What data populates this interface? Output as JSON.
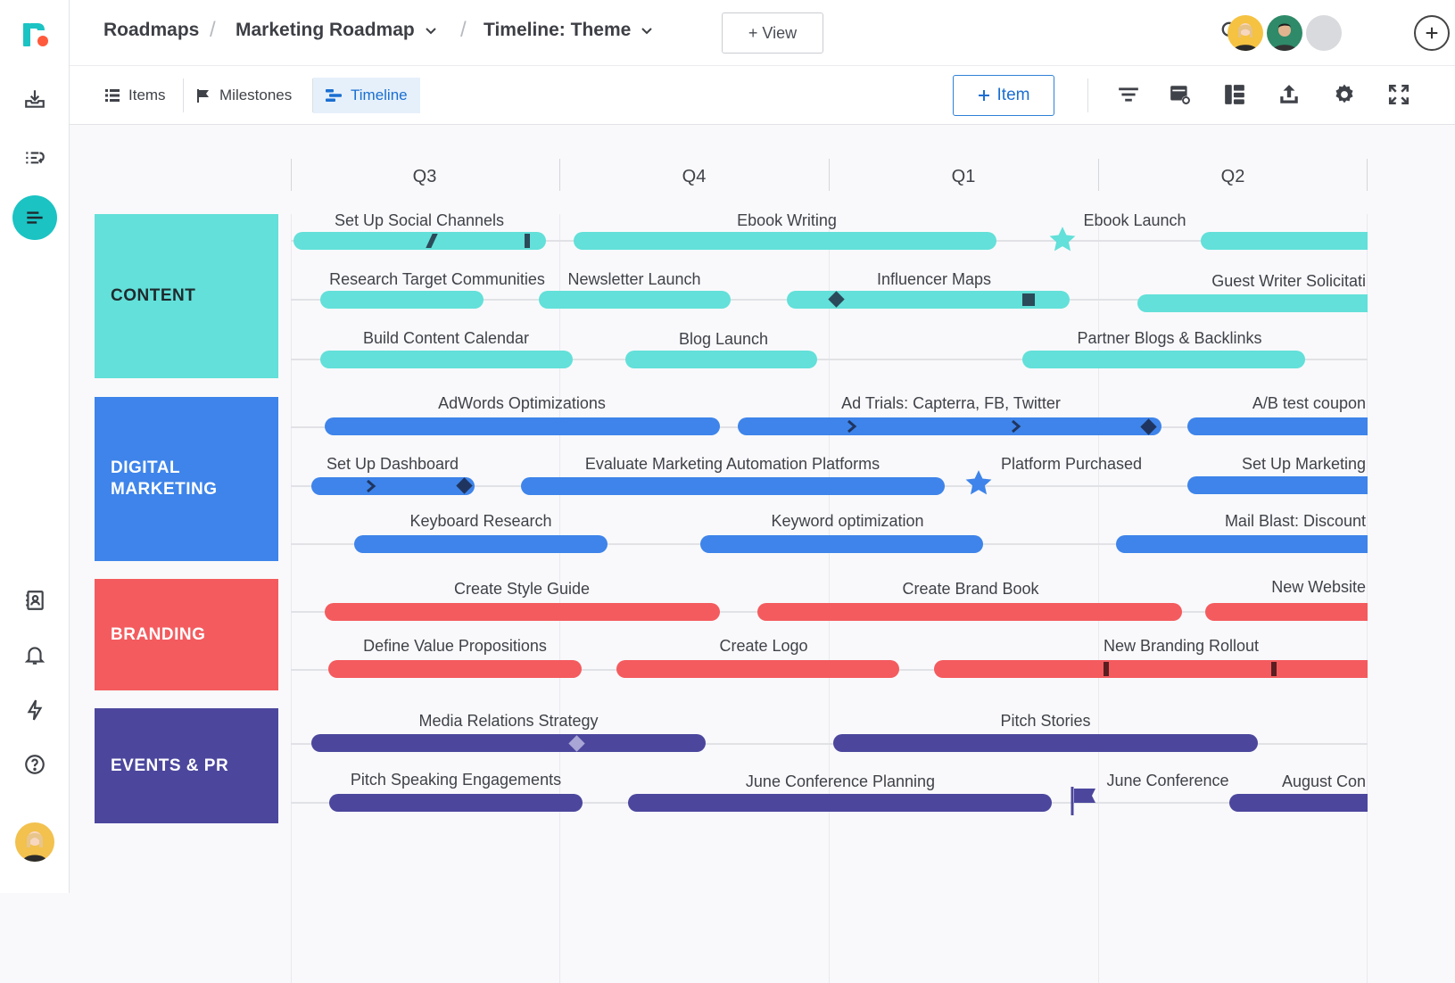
{
  "app": {
    "brand_color": "#1bc3c3",
    "accent_color": "#1a6fd1"
  },
  "breadcrumb": {
    "root": "Roadmaps",
    "roadmap": "Marketing Roadmap",
    "view": "Timeline: Theme"
  },
  "header": {
    "view_button": "+ View"
  },
  "toolbar": {
    "tabs": [
      {
        "label": "Items",
        "icon": "list-icon"
      },
      {
        "label": "Milestones",
        "icon": "flag-icon"
      },
      {
        "label": "Timeline",
        "icon": "timeline-icon",
        "active": true
      }
    ],
    "add_item_label": "Item",
    "tools": [
      "filter-icon",
      "card-settings-icon",
      "layout-icon",
      "export-icon",
      "gear-icon",
      "fullscreen-icon"
    ]
  },
  "timeline": {
    "quarters": [
      "Q3",
      "Q4",
      "Q1",
      "Q2"
    ],
    "themes": [
      {
        "name": "Content",
        "color": "#62e0d9"
      },
      {
        "name": "Digital Marketing",
        "color": "#3e84ea"
      },
      {
        "name": "Branding",
        "color": "#f45b5e"
      },
      {
        "name": "Events & PR",
        "color": "#4c479d"
      }
    ],
    "items": {
      "content": [
        "Set Up Social Channels",
        "Ebook Writing",
        "Ebook Launch",
        "Research Target Communities",
        "Newsletter Launch",
        "Influencer Maps",
        "Guest Writer Solicitati",
        "Build Content Calendar",
        "Blog Launch",
        "Partner Blogs & Backlinks"
      ],
      "digital": [
        "AdWords Optimizations",
        "Ad Trials: Capterra, FB, Twitter",
        "A/B test coupon",
        "Set Up Dashboard",
        "Evaluate Marketing Automation Platforms",
        "Platform Purchased",
        "Set Up Marketing",
        "Keyboard Research",
        "Keyword optimization",
        "Mail Blast: Discount"
      ],
      "branding": [
        "Create Style Guide",
        "Create Brand Book",
        "New Website",
        "Define Value Propositions",
        "Create Logo",
        "New Branding Rollout"
      ],
      "events": [
        "Media Relations Strategy",
        "Pitch Stories",
        "Pitch Speaking Engagements",
        "June Conference Planning",
        "June Conference",
        "August Con"
      ]
    }
  }
}
